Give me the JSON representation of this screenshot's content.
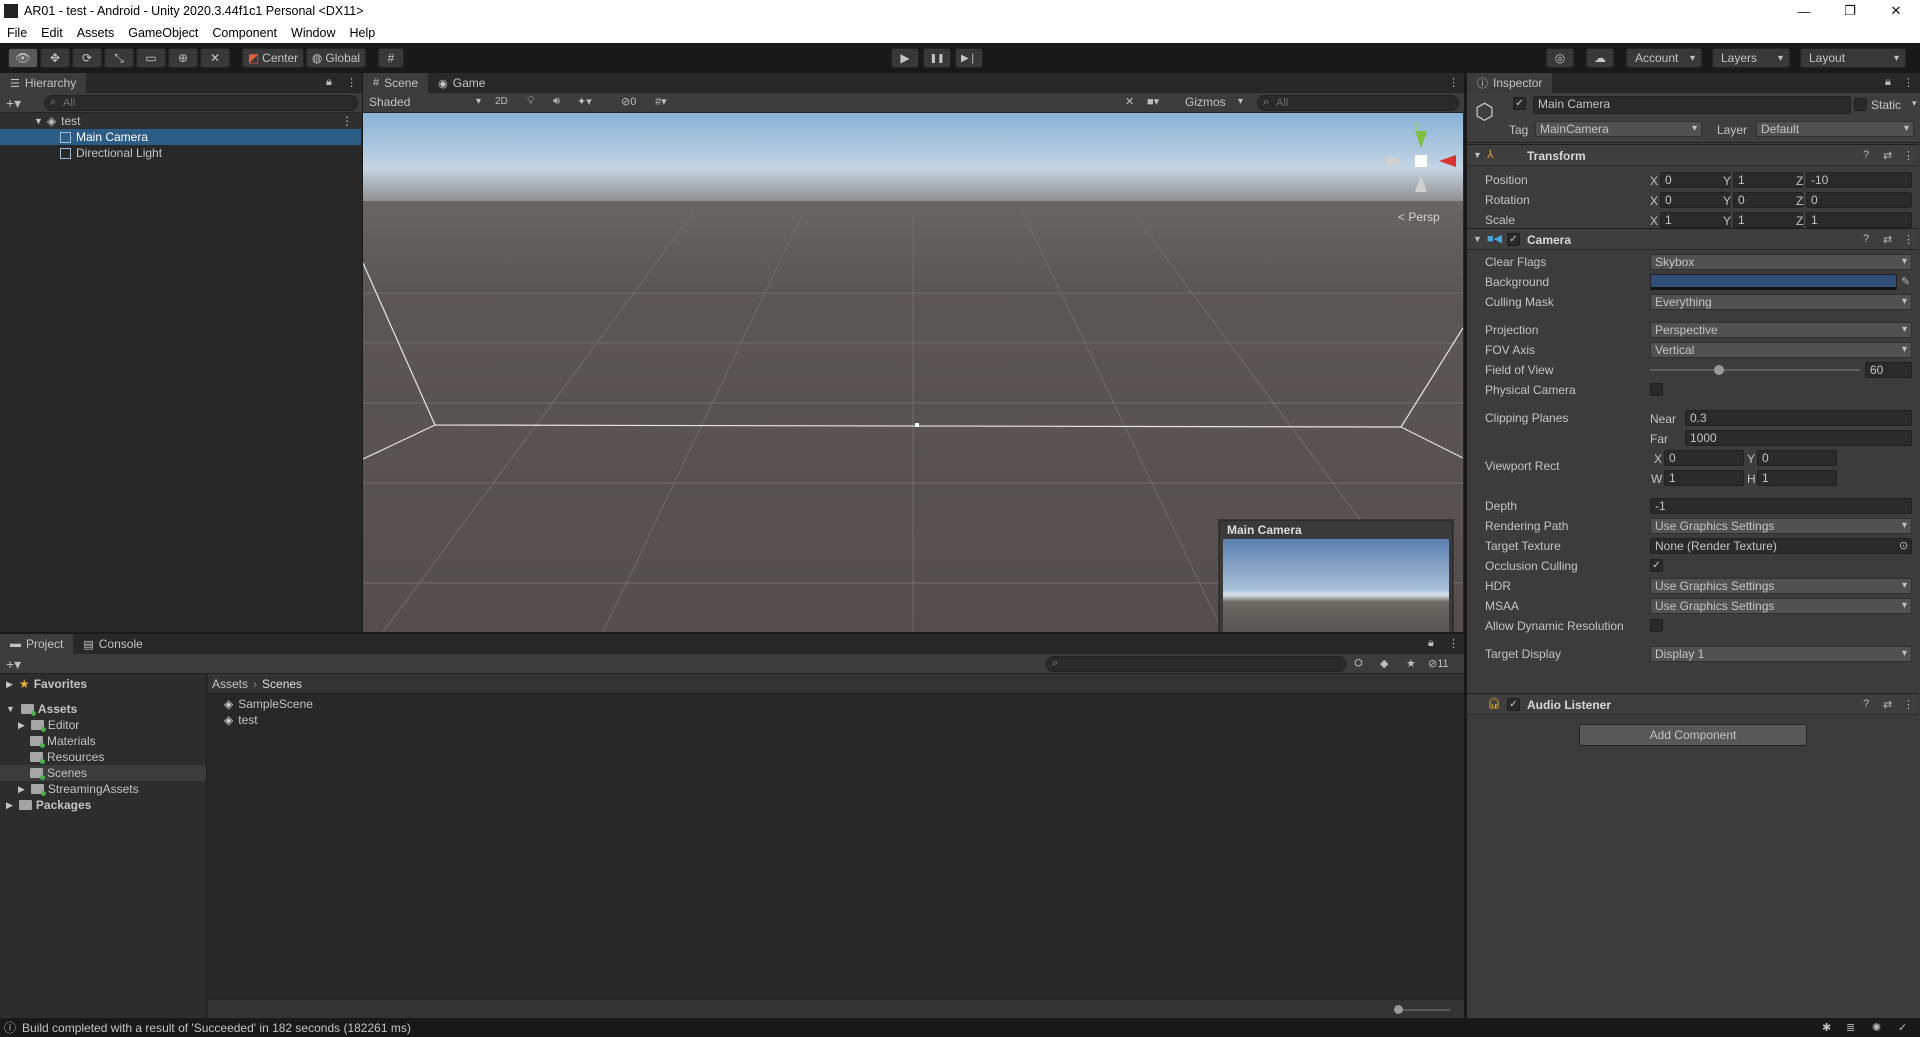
{
  "window": {
    "title": "AR01 - test - Android - Unity 2020.3.44f1c1 Personal <DX11>",
    "minimize": "—",
    "restore": "❐",
    "close": "✕"
  },
  "menu": [
    "File",
    "Edit",
    "Assets",
    "GameObject",
    "Component",
    "Window",
    "Help"
  ],
  "toolbar": {
    "center": "Center",
    "global": "Global",
    "account": "Account",
    "layers": "Layers",
    "layout": "Layout",
    "play": "▶",
    "pause": "❚❚",
    "step": "▶❘"
  },
  "hierarchy": {
    "tab": "Hierarchy",
    "search_placeholder": "All",
    "scene": "test",
    "items": [
      "Main Camera",
      "Directional Light"
    ]
  },
  "scene_view": {
    "tabs": [
      "Scene",
      "Game"
    ],
    "shading": "Shaded",
    "mode2d": "2D",
    "hidden_count": "0",
    "gizmos": "Gizmos",
    "search_placeholder": "All",
    "persp": "< Persp",
    "gizmo_y": "y",
    "preview_title": "Main Camera"
  },
  "project": {
    "tabs": [
      "Project",
      "Console"
    ],
    "favorites": "Favorites",
    "assets": "Assets",
    "folders": [
      "Editor",
      "Materials",
      "Resources",
      "Scenes",
      "StreamingAssets"
    ],
    "packages": "Packages",
    "breadcrumb": [
      "Assets",
      "Scenes"
    ],
    "files": [
      "SampleScene",
      "test"
    ],
    "hidden_count": "11"
  },
  "inspector": {
    "tab": "Inspector",
    "object_name": "Main Camera",
    "static": "Static",
    "tag_label": "Tag",
    "tag": "MainCamera",
    "layer_label": "Layer",
    "layer": "Default",
    "transform": {
      "title": "Transform",
      "rows": [
        {
          "label": "Position",
          "x": "0",
          "y": "1",
          "z": "-10"
        },
        {
          "label": "Rotation",
          "x": "0",
          "y": "0",
          "z": "0"
        },
        {
          "label": "Scale",
          "x": "1",
          "y": "1",
          "z": "1"
        }
      ]
    },
    "camera": {
      "title": "Camera",
      "clear_flags": {
        "label": "Clear Flags",
        "value": "Skybox"
      },
      "background": {
        "label": "Background",
        "color": "#314d79"
      },
      "culling_mask": {
        "label": "Culling Mask",
        "value": "Everything"
      },
      "projection": {
        "label": "Projection",
        "value": "Perspective"
      },
      "fov_axis": {
        "label": "FOV Axis",
        "value": "Vertical"
      },
      "fov": {
        "label": "Field of View",
        "value": "60",
        "fraction": 0.33
      },
      "physical": {
        "label": "Physical Camera"
      },
      "clipping": {
        "label": "Clipping Planes",
        "near_label": "Near",
        "near": "0.3",
        "far_label": "Far",
        "far": "1000"
      },
      "viewport": {
        "label": "Viewport Rect",
        "x": "0",
        "y": "0",
        "w": "1",
        "h": "1"
      },
      "depth": {
        "label": "Depth",
        "value": "-1"
      },
      "rendering_path": {
        "label": "Rendering Path",
        "value": "Use Graphics Settings"
      },
      "target_texture": {
        "label": "Target Texture",
        "value": "None (Render Texture)"
      },
      "occlusion": {
        "label": "Occlusion Culling",
        "check": "✓"
      },
      "hdr": {
        "label": "HDR",
        "value": "Use Graphics Settings"
      },
      "msaa": {
        "label": "MSAA",
        "value": "Use Graphics Settings"
      },
      "dynres": {
        "label": "Allow Dynamic Resolution"
      },
      "target_display": {
        "label": "Target Display",
        "value": "Display 1"
      }
    },
    "audio": {
      "title": "Audio Listener"
    },
    "add_component": "Add Component"
  },
  "status": "Build completed with a result of 'Succeeded' in 182 seconds (182261 ms)",
  "colors": {
    "selection": "#2c5d87",
    "panel": "#282828",
    "header": "#3c3c3c"
  }
}
